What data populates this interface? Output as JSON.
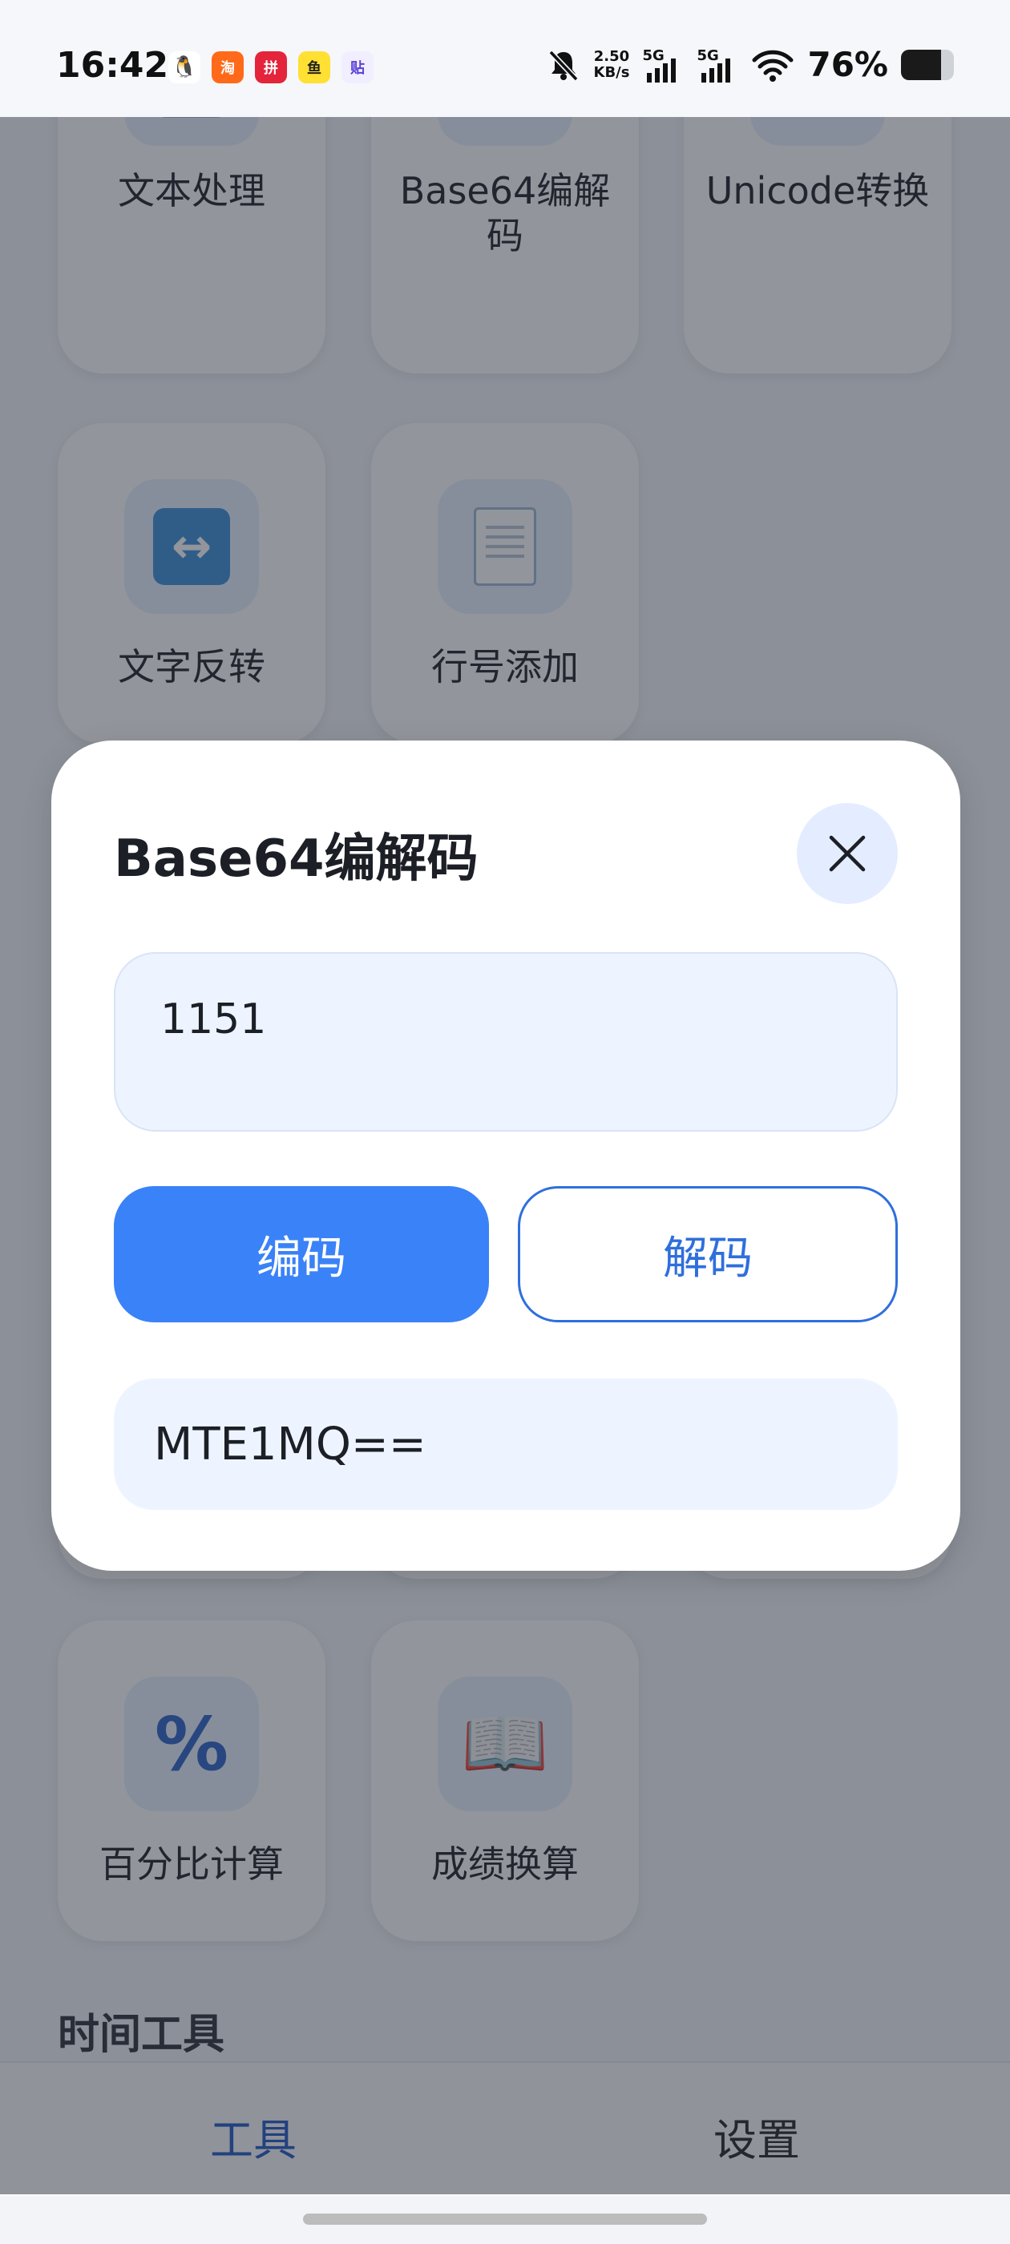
{
  "status_bar": {
    "time": "16:42",
    "net_speed_value": "2.50",
    "net_speed_unit": "KB/s",
    "signal_1_label": "5G",
    "signal_2_label": "5G",
    "battery_percent": "76%",
    "battery_level": 0.76,
    "app_icons": [
      "qq-icon",
      "taobao-icon",
      "pinduoduo-icon",
      "xianyu-icon",
      "tieba-icon"
    ]
  },
  "tool_cards": [
    {
      "label": "文本处理",
      "icon": "memo-icon"
    },
    {
      "label": "Base64编解码",
      "icon": "arrows-cycle-icon"
    },
    {
      "label": "Unicode转换",
      "icon": "abc-icon"
    },
    {
      "label": "文字反转",
      "icon": "left-right-arrow-icon"
    },
    {
      "label": "行号添加",
      "icon": "document-icon"
    },
    {
      "label": "百分比计算",
      "icon": "percent-icon"
    },
    {
      "label": "成绩换算",
      "icon": "open-book-icon"
    }
  ],
  "section_time_tools": "时间工具",
  "bottom_nav": {
    "tools": "工具",
    "settings": "设置"
  },
  "dialog": {
    "title": "Base64编解码",
    "input_value": "1151",
    "encode_label": "编码",
    "decode_label": "解码",
    "result": "MTE1MQ=="
  },
  "colors": {
    "primary": "#3a82f7",
    "outline_text": "#2f6fdc",
    "nav_active": "#1f56c7",
    "input_bg": "#eef4ff"
  }
}
